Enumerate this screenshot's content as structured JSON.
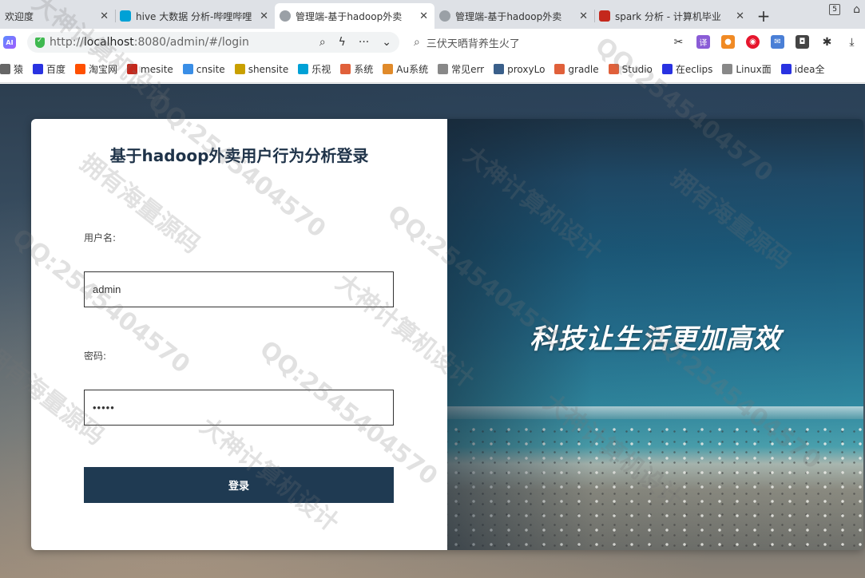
{
  "browser": {
    "tabs": [
      {
        "title": "欢迎度",
        "active": false,
        "icon": "generic-tab-icon",
        "color": "#888888"
      },
      {
        "title": "hive 大数据 分析-哔哩哔哩",
        "active": false,
        "icon": "bilibili-icon",
        "color": "#00a1d6"
      },
      {
        "title": "管理端-基于hadoop外卖",
        "active": true,
        "icon": "globe-icon",
        "color": "#7a7a7a"
      },
      {
        "title": "管理端-基于hadoop外卖",
        "active": false,
        "icon": "globe-icon",
        "color": "#7a7a7a"
      },
      {
        "title": "spark 分析 - 计算机毕业",
        "active": false,
        "icon": "csdn-icon",
        "color": "#c4281c"
      }
    ],
    "new_tab": "+",
    "tab_count": "5",
    "url_host": "localhost",
    "url_prefix": "http://",
    "url_suffix": ":8080/admin/#/login",
    "search_text": "三伏天晒背养生火了",
    "bookmarks": [
      {
        "label": "猿",
        "color": "#666666"
      },
      {
        "label": "百度",
        "color": "#2932e1"
      },
      {
        "label": "淘宝网",
        "color": "#ff5000"
      },
      {
        "label": "mesite",
        "color": "#c4281c"
      },
      {
        "label": "cnsite",
        "color": "#3a8ee6"
      },
      {
        "label": "shensite",
        "color": "#c9a000"
      },
      {
        "label": "乐视",
        "color": "#00a1d6"
      },
      {
        "label": "系统",
        "color": "#e0603a"
      },
      {
        "label": "Au系统",
        "color": "#e08a2a"
      },
      {
        "label": "常见err",
        "color": "#888888"
      },
      {
        "label": "proxyLo",
        "color": "#3a5f8a"
      },
      {
        "label": "gradle",
        "color": "#e0603a"
      },
      {
        "label": "Studio",
        "color": "#e0603a"
      },
      {
        "label": "在eclips",
        "color": "#2932e1"
      },
      {
        "label": "Linux面",
        "color": "#888888"
      },
      {
        "label": "idea全",
        "color": "#2932e1"
      }
    ]
  },
  "login": {
    "title": "基于hadoop外卖用户行为分析登录",
    "username_label": "用户名:",
    "username_value": "admin",
    "password_label": "密码:",
    "password_value": "•••••",
    "submit_label": "登录"
  },
  "hero": {
    "slogan": "科技让生活更加高效"
  },
  "watermark": {
    "lines": [
      "大神计算机设计",
      "QQ:2545404570",
      "拥有海量源码"
    ]
  }
}
